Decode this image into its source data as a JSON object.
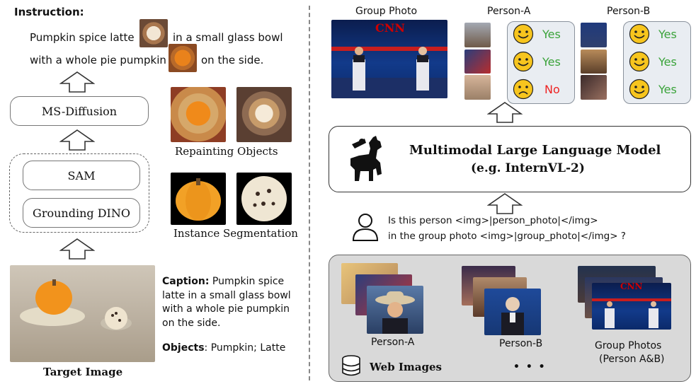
{
  "left": {
    "instruction_heading": "Instruction:",
    "instruction_line1": "Pumpkin spice latte",
    "instruction_line1b": "in a small glass bowl",
    "instruction_line2": "with a whole pie pumpkin",
    "instruction_line2b": "on the side.",
    "ms_diffusion": "MS-Diffusion",
    "sam": "SAM",
    "grounding_dino": "Grounding DINO",
    "repainting_objects": "Repainting Objects",
    "instance_segmentation": "Instance Segmentation",
    "caption_heading": "Caption:",
    "caption_text_1": "Pumpkin spice",
    "caption_text_2": "latte in a small glass bowl",
    "caption_text_3": "with a whole pie pumpkin",
    "caption_text_4": "on the side.",
    "objects_heading": "Objects",
    "objects_text": ": Pumpkin; Latte",
    "target_image": "Target Image"
  },
  "right": {
    "group_photo": "Group Photo",
    "person_a": "Person-A",
    "person_b": "Person-B",
    "cnn_logo": "CNN",
    "a_results": [
      "Yes",
      "Yes",
      "No"
    ],
    "b_results": [
      "Yes",
      "Yes",
      "Yes"
    ],
    "mllm_title": "Multimodal Large Language Model",
    "mllm_subtitle": "(e.g. InternVL-2)",
    "question_line1": "Is this person <img>|person_photo|</img>",
    "question_line2": "in the group photo <img>|group_photo|</img> ?",
    "web_person_a": "Person-A",
    "web_person_b": "Person-B",
    "web_group_photos": "Group Photos",
    "web_group_photos_sub": "(Person A&B)",
    "web_images": "Web Images",
    "ellipsis": "• • •"
  },
  "colors": {
    "yes": "#3aa33a",
    "no": "#e22222",
    "smiley": "#f7c51e",
    "panel": "#e9edf2",
    "web_panel": "#d9d9d9",
    "cnn_red": "#cc0000"
  }
}
